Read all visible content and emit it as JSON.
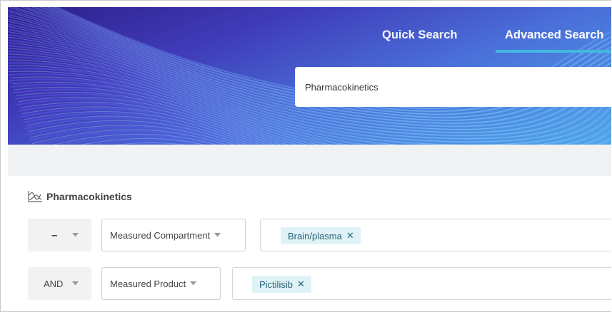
{
  "tabs": {
    "quick": "Quick Search",
    "advanced": "Advanced Search"
  },
  "search": {
    "value": "Pharmacokinetics"
  },
  "section": {
    "title": "Pharmacokinetics",
    "icon": "chart-trend-icon"
  },
  "rows": [
    {
      "operator": "–",
      "field": "Measured Compartment",
      "chip": "Brain/plasma"
    },
    {
      "operator": "AND",
      "field": "Measured Product",
      "chip": "Pictilisib"
    }
  ],
  "glyphs": {
    "remove": "✕"
  },
  "colors": {
    "tab_underline": "#43b8e0",
    "chip_bg": "#dff3f7",
    "chip_text": "#2a5f73"
  }
}
